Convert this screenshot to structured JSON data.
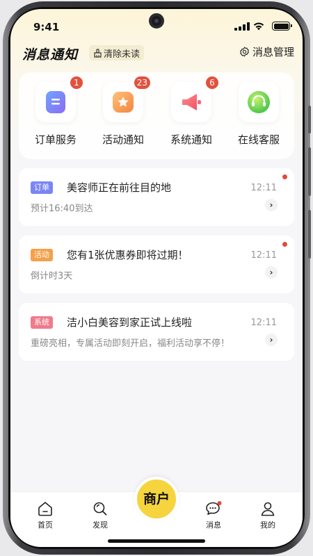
{
  "status": {
    "time": "9:41"
  },
  "header": {
    "title": "消息通知",
    "clear_label": "清除未读",
    "manage_label": "消息管理"
  },
  "categories": [
    {
      "label": "订单服务",
      "badge": "1",
      "icon": "order-icon"
    },
    {
      "label": "活动通知",
      "badge": "23",
      "icon": "star-activity-icon"
    },
    {
      "label": "系统通知",
      "badge": "6",
      "icon": "megaphone-icon"
    },
    {
      "label": "在线客服",
      "badge": "",
      "icon": "headset-icon"
    }
  ],
  "messages": [
    {
      "tag": "订单",
      "tag_color": "#7a86f4",
      "title": "美容师正在前往目的地",
      "subtitle": "预计16:40到达",
      "time": "12:11",
      "unread": true
    },
    {
      "tag": "活动",
      "tag_color": "#f5a04a",
      "title": "您有1张优惠券即将过期！",
      "subtitle": "倒计时3天",
      "time": "12:11",
      "unread": true
    },
    {
      "tag": "系统",
      "tag_color": "#f07b8a",
      "title": "洁小白美容到家正试上线啦",
      "subtitle": "重磅亮相，专属活动即刻开启，福利活动享不停！",
      "time": "12:11",
      "unread": false
    }
  ],
  "tabbar": {
    "home": "首页",
    "discover": "发现",
    "merchant": "商户",
    "messages": "消息",
    "mine": "我的"
  }
}
